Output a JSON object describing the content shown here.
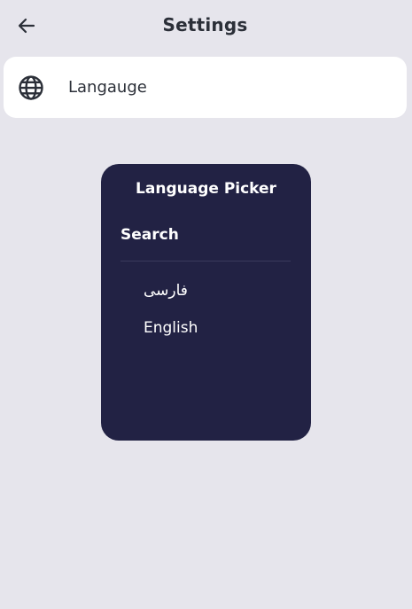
{
  "appbar": {
    "title": "Settings",
    "back_icon": "arrow-left-icon"
  },
  "settings": {
    "language_item": {
      "icon": "globe-icon",
      "label": "Langauge"
    }
  },
  "dialog": {
    "title": "Language Picker",
    "search_placeholder": "Search",
    "options": [
      {
        "label": "فارسی"
      },
      {
        "label": "English"
      }
    ]
  },
  "colors": {
    "background": "#e6e5ec",
    "card": "#ffffff",
    "dialog": "#222244",
    "text_dark": "#2b2f38",
    "text_light": "#ffffff"
  }
}
